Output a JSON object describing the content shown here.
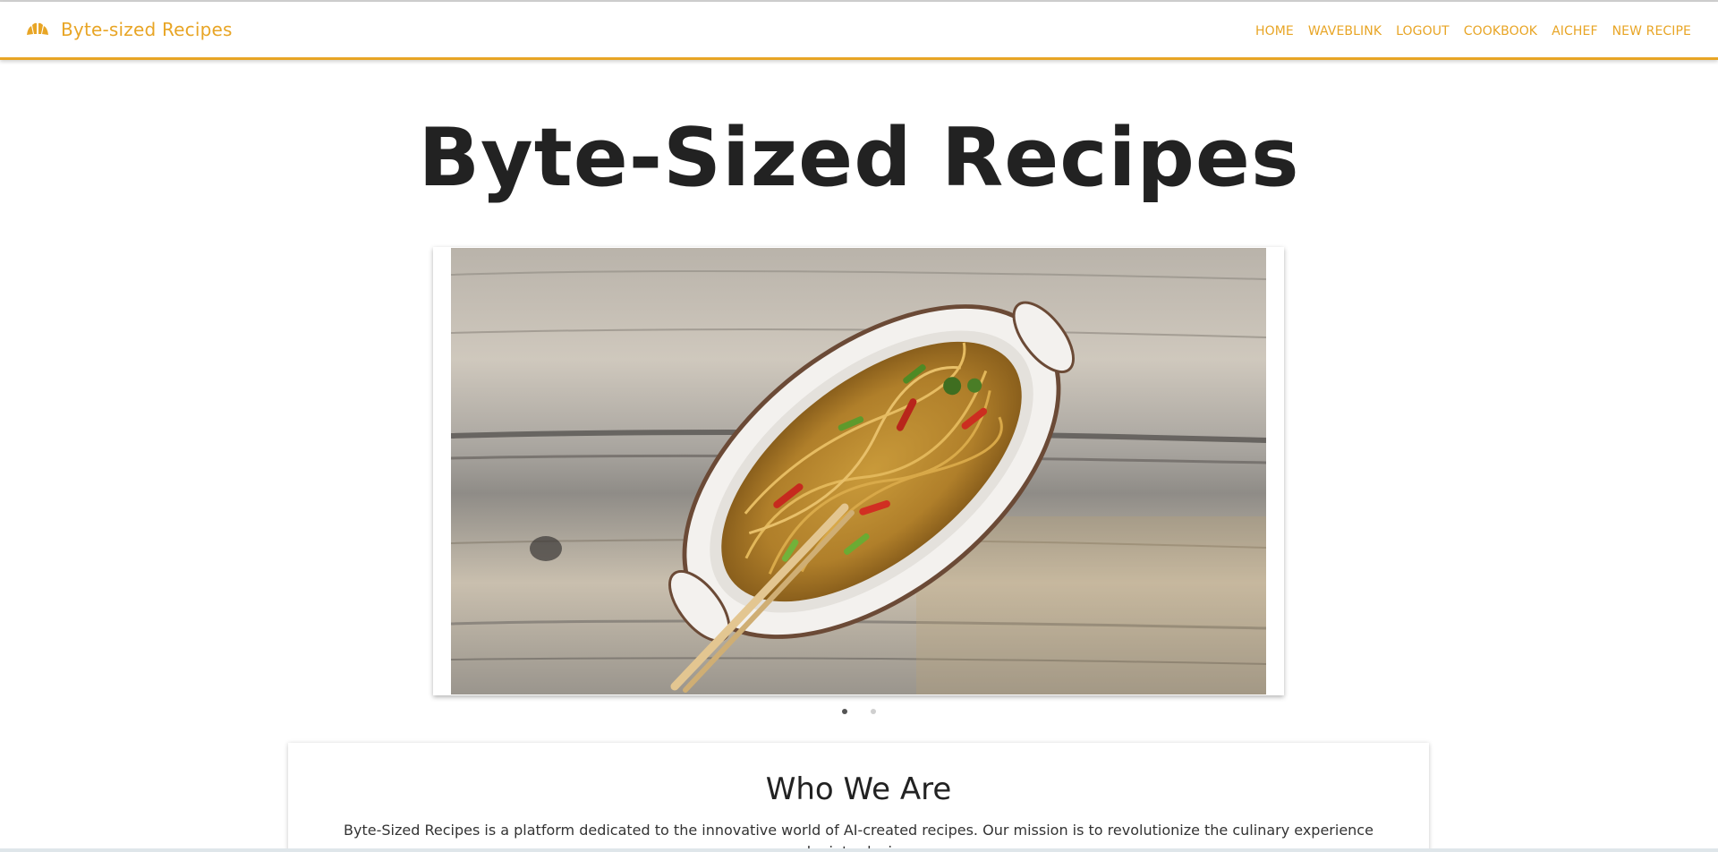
{
  "navbar": {
    "brand_text": "Byte-sized Recipes",
    "brand_icon": "croissant-icon",
    "accent_color": "#e8a525",
    "links": [
      {
        "label": "HOME"
      },
      {
        "label": "WAVEBLINK"
      },
      {
        "label": "LOGOUT"
      },
      {
        "label": "COOKBOOK"
      },
      {
        "label": "AICHEF"
      },
      {
        "label": "NEW RECIPE"
      }
    ]
  },
  "hero": {
    "title": "Byte-Sized Recipes"
  },
  "carousel": {
    "active_slide": 1,
    "slide_count": 2
  },
  "about": {
    "title": "Who We Are",
    "text": "Byte-Sized Recipes is a platform dedicated to the innovative world of AI-created recipes. Our mission is to revolutionize the culinary experience by introducing"
  }
}
